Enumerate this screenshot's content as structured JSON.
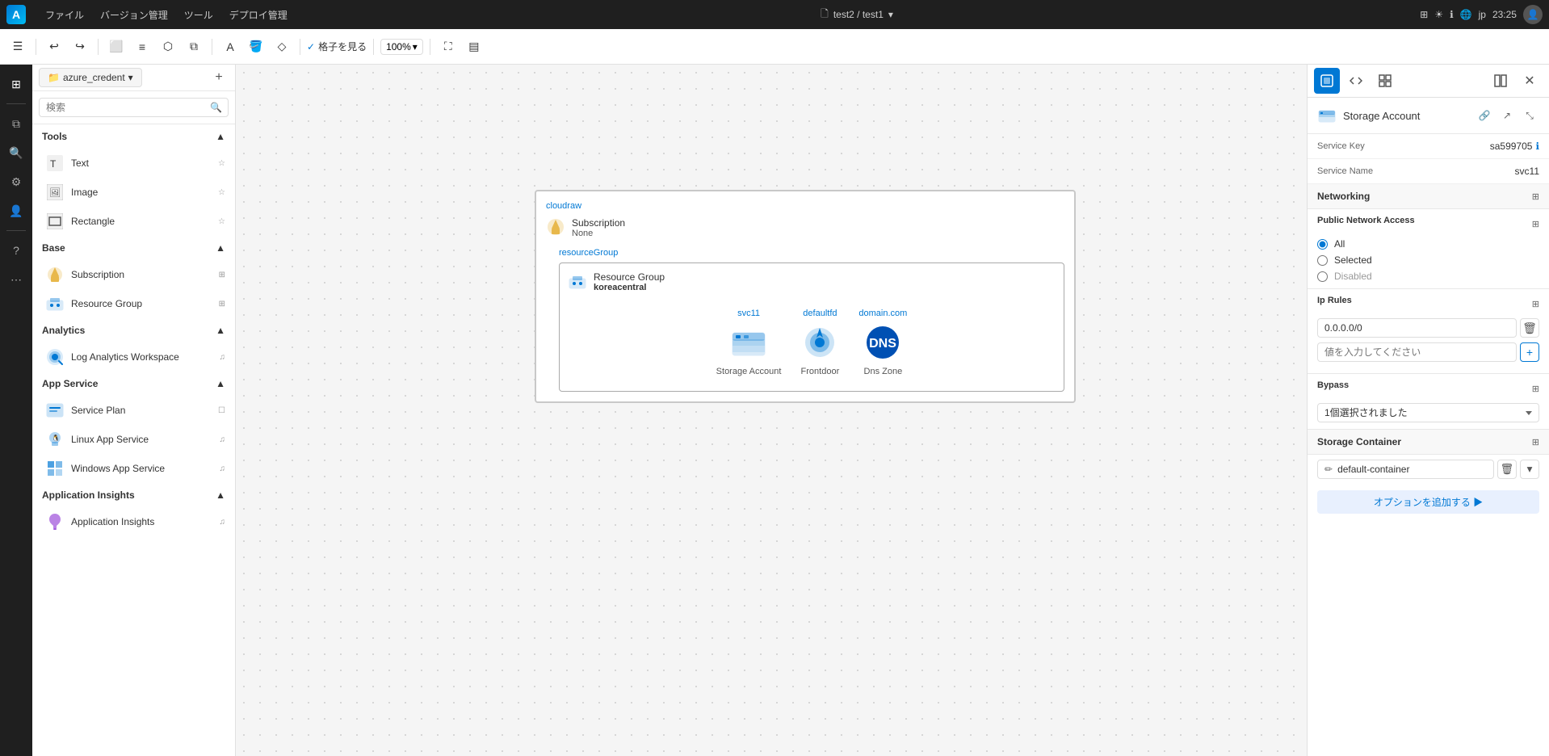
{
  "titlebar": {
    "menu_items": [
      "ファイル",
      "バージョン管理",
      "ツール",
      "デプロイ管理"
    ],
    "path": "test2 / test1",
    "time": "23:25",
    "lang": "jp"
  },
  "toolbar": {
    "grid_label": "格子を見る",
    "zoom_value": "100%"
  },
  "sidebar": {
    "search_placeholder": "検索",
    "sections": [
      {
        "title": "Tools",
        "items": [
          {
            "label": "Text",
            "icon": "text-icon"
          },
          {
            "label": "Image",
            "icon": "image-icon"
          },
          {
            "label": "Rectangle",
            "icon": "rectangle-icon"
          }
        ]
      },
      {
        "title": "Base",
        "items": [
          {
            "label": "Subscription",
            "icon": "subscription-icon"
          },
          {
            "label": "Resource Group",
            "icon": "resource-group-icon"
          }
        ]
      },
      {
        "title": "Analytics",
        "items": [
          {
            "label": "Log Analytics Workspace",
            "icon": "analytics-icon"
          }
        ]
      },
      {
        "title": "App Service",
        "items": [
          {
            "label": "Service Plan",
            "icon": "service-plan-icon"
          },
          {
            "label": "Linux App Service",
            "icon": "linux-app-icon"
          },
          {
            "label": "Windows App Service",
            "icon": "windows-app-icon"
          }
        ]
      },
      {
        "title": "Application Insights",
        "items": [
          {
            "label": "Application Insights",
            "icon": "app-insights-icon"
          }
        ]
      }
    ]
  },
  "diagram": {
    "canvas_label": "cloudraw",
    "subscription_title": "Subscription",
    "subscription_value": "None",
    "rg_label": "resourceGroup",
    "rg_title": "Resource Group",
    "rg_value": "koreacentral",
    "resources": [
      {
        "label": "svc11",
        "name": "Storage Account",
        "type": "storage"
      },
      {
        "label": "defaultfd",
        "name": "Frontdoor",
        "type": "frontdoor"
      },
      {
        "label": "domain.com",
        "name": "Dns Zone",
        "type": "dns"
      }
    ]
  },
  "right_panel": {
    "header_title": "Storage Account",
    "service_key_label": "Service Key",
    "service_key_value": "sa599705",
    "service_name_label": "Service Name",
    "service_name_value": "svc11",
    "networking_title": "Networking",
    "public_network_access_title": "Public Network Access",
    "radio_options": [
      {
        "label": "All",
        "value": "all",
        "checked": true
      },
      {
        "label": "Selected",
        "value": "selected",
        "checked": false
      },
      {
        "label": "Disabled",
        "value": "disabled",
        "checked": false
      }
    ],
    "ip_rules_title": "Ip Rules",
    "ip_rules_value": "0.0.0.0/0",
    "ip_input_placeholder": "値を入力してください",
    "bypass_title": "Bypass",
    "bypass_value": "1個選択されました",
    "storage_container_title": "Storage Container",
    "container_name": "default-container",
    "add_option_label": "オプションを追加する ▶"
  }
}
